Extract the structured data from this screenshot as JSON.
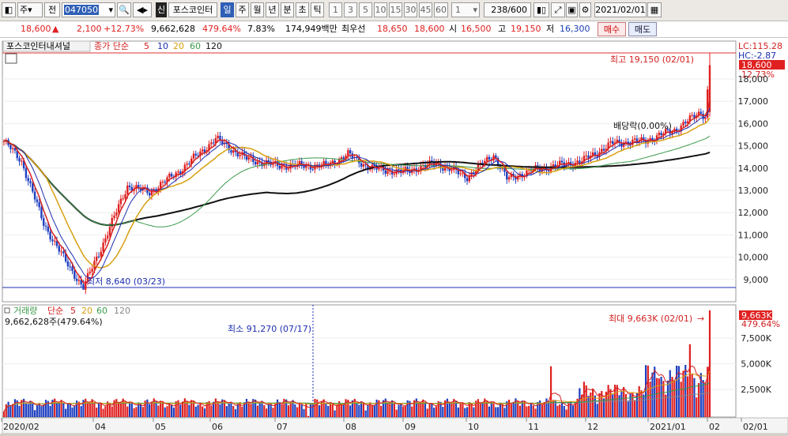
{
  "toolbar": {
    "market": "주",
    "range": "전",
    "code": "047050",
    "badge": "신",
    "stock_name": "포스코인터",
    "periods": [
      "일",
      "주",
      "월",
      "년",
      "분",
      "초",
      "틱"
    ],
    "active_period": "일",
    "numbers": [
      "1",
      "3",
      "5",
      "10",
      "15",
      "30",
      "45",
      "60"
    ],
    "unit": "1",
    "counter": "238/600",
    "date": "2021/02/01"
  },
  "quote": {
    "price": "18,600",
    "change": "2,100",
    "change_pct": "+12.73%",
    "volume": "9,662,628",
    "volume_ratio": "479.64%",
    "turnover": "7.83%",
    "amount": "174,949백만",
    "preferred_label": "최우선",
    "ask": "18,650",
    "bid": "18,600",
    "open_label": "시",
    "open": "16,500",
    "high_label": "고",
    "high": "19,150",
    "low_label": "저",
    "low": "16,300",
    "buy_label": "매수",
    "sell_label": "매도"
  },
  "price_panel": {
    "tab": "포스코인터내셔널",
    "legend_label": "종가 단순",
    "ma": [
      "5",
      "10",
      "20",
      "60",
      "120"
    ],
    "ma_colors": [
      "#d42020",
      "#1e2fb0",
      "#d8a010",
      "#3a9a4a",
      "#111111"
    ],
    "max_note": "최고 19,150 (02/01)",
    "min_note": "최저 8,640 (03/23)",
    "dividend_note": "배당락(0.00%)",
    "lc": "LC:115.28",
    "hc": "HC:-2.87",
    "last_price": "18,600",
    "last_pct": "12.73%",
    "y_ticks": [
      "18,000",
      "17,000",
      "16,000",
      "15,000",
      "14,000",
      "13,000",
      "12,000",
      "11,000",
      "10,000",
      "9,000"
    ]
  },
  "volume_panel": {
    "label": "거래량",
    "legend_label": "단순",
    "ma": [
      "5",
      "20",
      "60",
      "120"
    ],
    "ma_colors": [
      "#d42020",
      "#d8a010",
      "#3a9a4a",
      "#888888"
    ],
    "current": "9,662,628주(479.64%)",
    "max_note": "최대 9,663K (02/01)",
    "min_note": "최소 91,270 (07/17)",
    "last_value": "9,663K",
    "last_pct": "479.64%",
    "y_ticks": [
      "7,500K",
      "5,000K",
      "2,500K"
    ]
  },
  "x_axis": [
    "2020/02",
    "04",
    "05",
    "06",
    "07",
    "08",
    "09",
    "10",
    "11",
    "12",
    "2021/01",
    "02",
    "02/01"
  ],
  "chart_data": {
    "type": "candlestick",
    "price_range": [
      8640,
      19150
    ],
    "key_prices": [
      {
        "date": "2020/03/23",
        "low": 8640
      },
      {
        "date": "2021/02/01",
        "open": 16500,
        "high": 19150,
        "low": 16300,
        "close": 18600
      }
    ],
    "volume_max": 9663000,
    "volume_min": 91270
  }
}
